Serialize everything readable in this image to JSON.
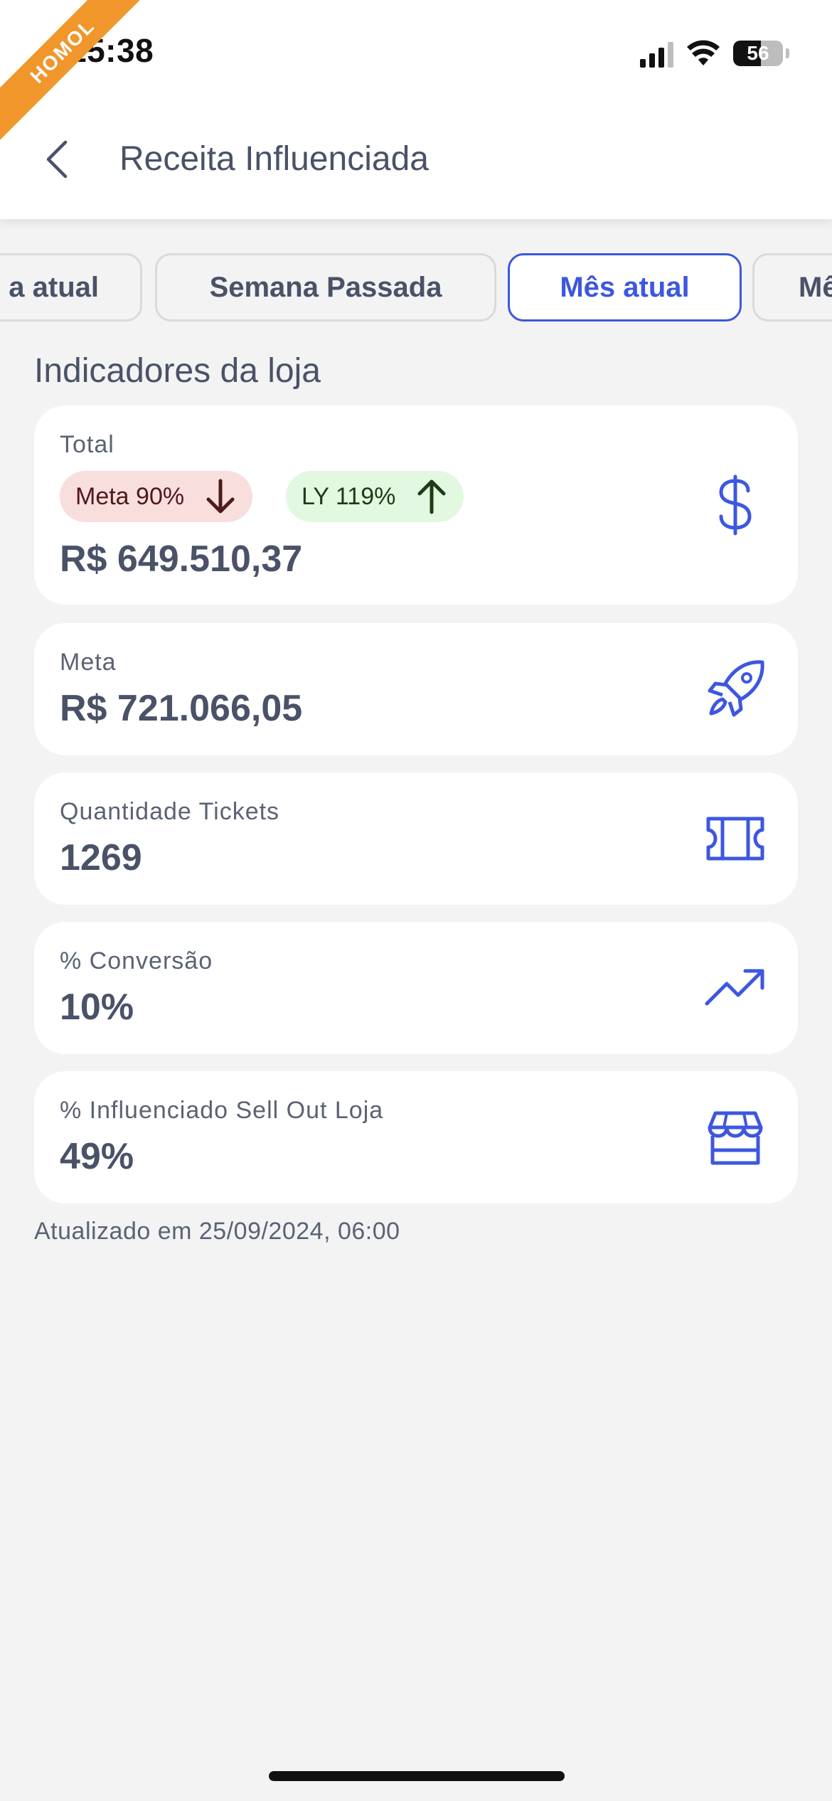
{
  "status_bar": {
    "time": "15:38",
    "battery": "56",
    "env_ribbon": "HOMOL"
  },
  "header": {
    "title": "Receita Influenciada"
  },
  "tabs": [
    {
      "label": "Semana atual",
      "visible_text": "a atual",
      "active": false
    },
    {
      "label": "Semana Passada",
      "active": false
    },
    {
      "label": "Mês atual",
      "active": true
    },
    {
      "label": "Mê",
      "active": false
    }
  ],
  "section": {
    "title": "Indicadores da loja"
  },
  "cards": {
    "total": {
      "label": "Total",
      "value": "R$ 649.510,37",
      "icon": "dollar-icon",
      "badges": {
        "meta": {
          "label": "Meta 90%",
          "direction": "down"
        },
        "ly": {
          "label": "LY 119%",
          "direction": "up"
        }
      }
    },
    "meta": {
      "label": "Meta",
      "value": "R$ 721.066,05",
      "icon": "rocket-icon"
    },
    "tickets": {
      "label": "Quantidade Tickets",
      "value": "1269",
      "icon": "ticket-icon"
    },
    "conversao": {
      "label": "% Conversão",
      "value": "10%",
      "icon": "trending-up-icon"
    },
    "influenciado": {
      "label": "% Influenciado Sell Out Loja",
      "value": "49%",
      "icon": "store-icon"
    }
  },
  "footer": {
    "updated": "Atualizado em 25/09/2024, 06:00"
  },
  "colors": {
    "accent": "#3d57e0",
    "background": "#f3f3f4",
    "text": "#4a5268",
    "badge_down_bg": "#f9dede",
    "badge_up_bg": "#e3f8e1",
    "ribbon": "#f0962a"
  }
}
